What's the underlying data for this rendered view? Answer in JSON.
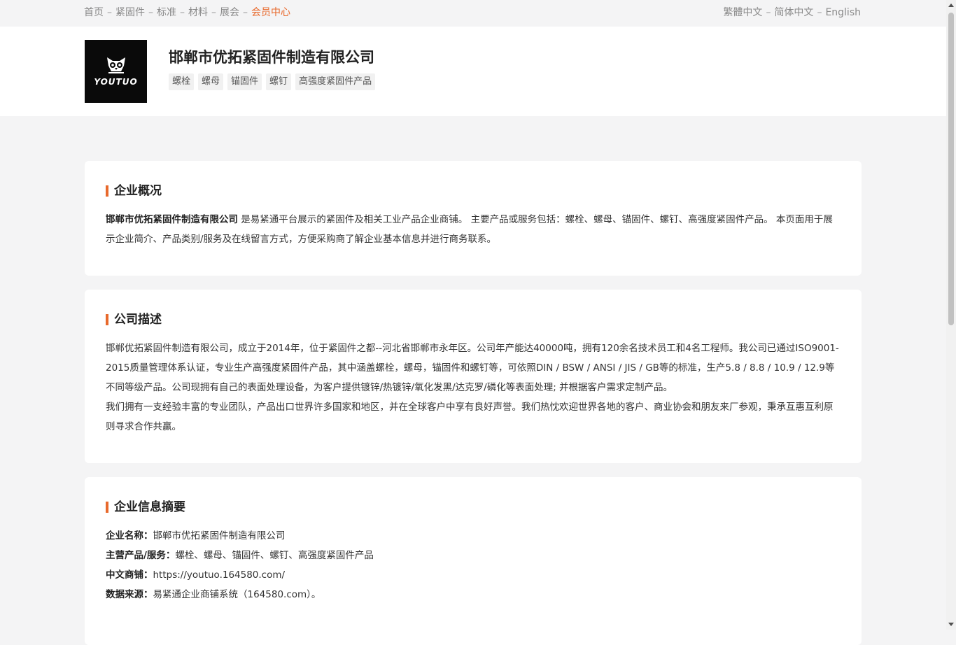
{
  "topnav": {
    "items": [
      {
        "label": "首页"
      },
      {
        "label": "紧固件"
      },
      {
        "label": "标准"
      },
      {
        "label": "材料"
      },
      {
        "label": "展会"
      },
      {
        "label": "会员中心"
      }
    ],
    "separator": "–"
  },
  "langnav": {
    "items": [
      {
        "label": "繁體中文"
      },
      {
        "label": "简体中文"
      },
      {
        "label": "English"
      }
    ]
  },
  "header": {
    "logo_text": "YOUTUO",
    "company_name": "邯郸市优拓紧固件制造有限公司",
    "tags": [
      "螺栓",
      "螺母",
      "锚固件",
      "螺钉",
      "高强度紧固件产品"
    ]
  },
  "overview": {
    "title": "企业概况",
    "company_bold": "邯郸市优拓紧固件制造有限公司",
    "text": " 是易紧通平台展示的紧固件及相关工业产品企业商铺。 主要产品或服务包括：螺栓、螺母、锚固件、螺钉、高强度紧固件产品。 本页面用于展示企业简介、产品类别/服务及在线留言方式，方便采购商了解企业基本信息并进行商务联系。"
  },
  "description": {
    "title": "公司描述",
    "para1": "邯郸优拓紧固件制造有限公司，成立于2014年，位于紧固件之都--河北省邯郸市永年区。公司年产能达40000吨，拥有120余名技术员工和4名工程师。我公司已通过ISO9001-2015质量管理体系认证，专业生产高强度紧固件产品，其中涵盖螺栓，螺母，锚固件和螺钉等，可依照DIN / BSW / ANSI / JIS / GB等的标准，生产5.8 / 8.8 / 10.9 / 12.9等不同等级产品。公司现拥有自己的表面处理设备，为客户提供镀锌/热镀锌/氧化发黑/达克罗/磷化等表面处理; 并根据客户需求定制产品。",
    "para2": "我们拥有一支经验丰富的专业团队，产品出口世界许多国家和地区，并在全球客户中享有良好声誉。我们热忱欢迎世界各地的客户、商业协会和朋友来厂参观，秉承互惠互利原则寻求合作共赢。"
  },
  "summary": {
    "title": "企业信息摘要",
    "rows": [
      {
        "key": "企业名称：",
        "value": "邯郸市优拓紧固件制造有限公司"
      },
      {
        "key": "主营产品/服务：",
        "value": "螺栓、螺母、锚固件、螺钉、高强度紧固件产品"
      },
      {
        "key": "中文商铺：",
        "value": "https://youtuo.164580.com/"
      },
      {
        "key": "数据来源：",
        "value": "易紧通企业商铺系统（164580.com）。"
      }
    ]
  },
  "colors": {
    "accent": "#e8692c",
    "page_bg": "#f4f4f5",
    "card_bg": "#ffffff"
  }
}
